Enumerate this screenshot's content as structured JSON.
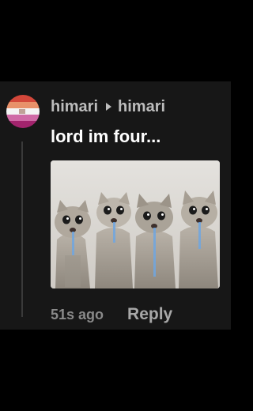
{
  "comment": {
    "author": "himari",
    "reply_to": "himari",
    "text": "lord im four...",
    "timestamp": "51s ago",
    "reply_label": "Reply"
  },
  "avatar": {
    "colors": [
      "#d3473a",
      "#e8916a",
      "#f4f4f4",
      "#cf6aa6",
      "#a2246d"
    ]
  },
  "attachment": {
    "description_icon": "crying-cats-meme",
    "background": "#dcdad6"
  }
}
